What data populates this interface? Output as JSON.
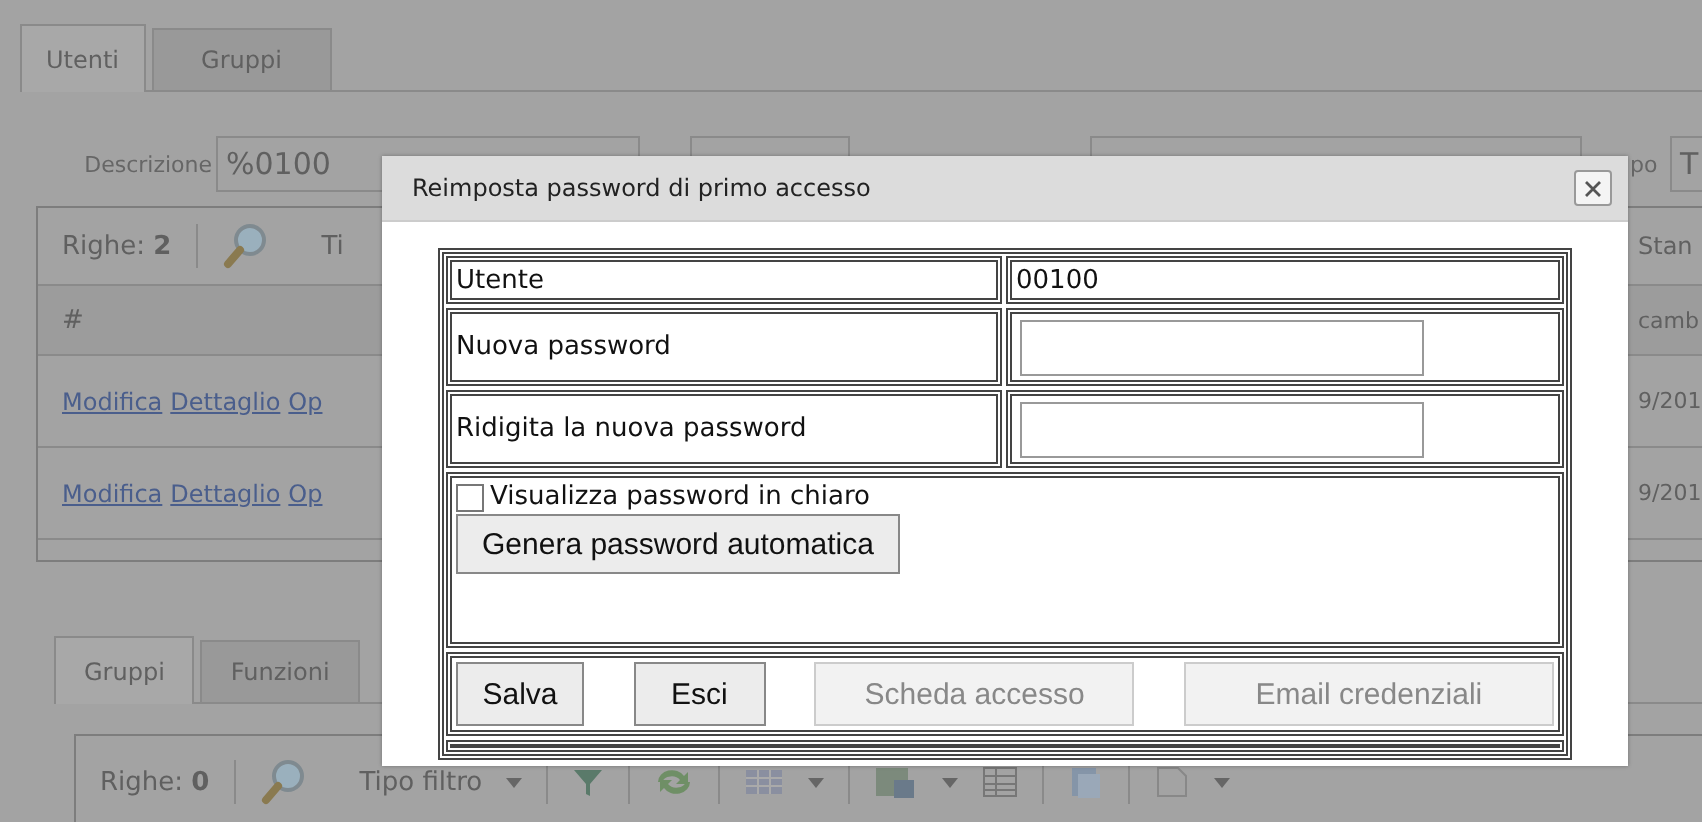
{
  "tabs": [
    {
      "label": "Utenti",
      "selected": true
    },
    {
      "label": "Gruppi",
      "selected": false
    }
  ],
  "filters": {
    "description_label": "Descrizione",
    "description_value": "%0100",
    "type_label": "po",
    "type_value": "T"
  },
  "grid": {
    "rows_label": "Righe:",
    "rows_count": "2",
    "filter_label": "Ti",
    "column_right": "Stan",
    "header": "#",
    "header_right": "camb",
    "rows": [
      {
        "links": [
          "Modifica",
          "Dettaglio",
          "Op"
        ],
        "column_right": "9/201"
      },
      {
        "links": [
          "Modifica",
          "Dettaglio",
          "Op"
        ],
        "column_right": "9/201"
      }
    ]
  },
  "lower_tabs": [
    {
      "label": "Gruppi",
      "selected": true
    },
    {
      "label": "Funzioni",
      "selected": false
    }
  ],
  "lower_toolbar": {
    "rows_label": "Righe:",
    "rows_count": "0",
    "filter_type": "Tipo filtro"
  },
  "dialog": {
    "title": "Reimposta password di primo accesso",
    "fields": [
      {
        "label": "Utente",
        "kind": "text",
        "value": "00100"
      },
      {
        "label": "Nuova password",
        "kind": "input"
      },
      {
        "label": "Ridigita la nuova password",
        "kind": "input"
      }
    ],
    "show_password": {
      "label": "Visualizza password in chiaro",
      "checked": false
    },
    "generate_button": "Genera password automatica",
    "buttons": [
      {
        "label": "Salva",
        "disabled": false
      },
      {
        "label": "Esci",
        "disabled": false
      },
      {
        "label": "Scheda accesso",
        "disabled": true
      },
      {
        "label": "Email credenziali",
        "disabled": true
      }
    ]
  }
}
